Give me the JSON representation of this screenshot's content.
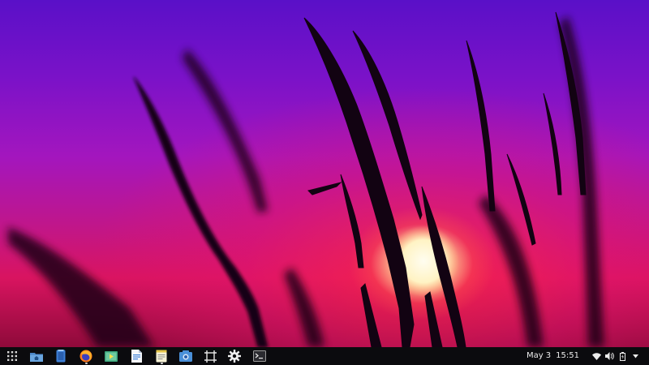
{
  "wallpaper": {
    "description_icon": "wheat-silhouette-sunset",
    "colors": {
      "sky_top": "#5a10c8",
      "sky_mid": "#a316be",
      "sky_low": "#d91460",
      "sun": "#fff7d8"
    }
  },
  "taskbar": {
    "launcher": {
      "icon": "app-grid-icon"
    },
    "apps": [
      {
        "name": "files-home",
        "icon": "home-folder-icon",
        "running": false
      },
      {
        "name": "sticky-notes",
        "icon": "sticky-note-icon",
        "running": false
      },
      {
        "name": "firefox",
        "icon": "firefox-icon",
        "running": true
      },
      {
        "name": "media-player",
        "icon": "video-player-icon",
        "running": false
      },
      {
        "name": "document-viewer",
        "icon": "document-icon",
        "running": false
      },
      {
        "name": "text-editor",
        "icon": "text-editor-icon",
        "running": true
      },
      {
        "name": "screenshot",
        "icon": "camera-icon",
        "running": false
      },
      {
        "name": "screen-capture",
        "icon": "capture-frame-icon",
        "running": false
      },
      {
        "name": "settings",
        "icon": "gear-icon",
        "running": false
      },
      {
        "name": "terminal",
        "icon": "terminal-icon",
        "running": false
      }
    ],
    "tray": {
      "date": "May 3",
      "time": "15:51",
      "icons": [
        "wifi-icon",
        "volume-icon",
        "battery-icon",
        "chevron-down-icon"
      ]
    }
  }
}
